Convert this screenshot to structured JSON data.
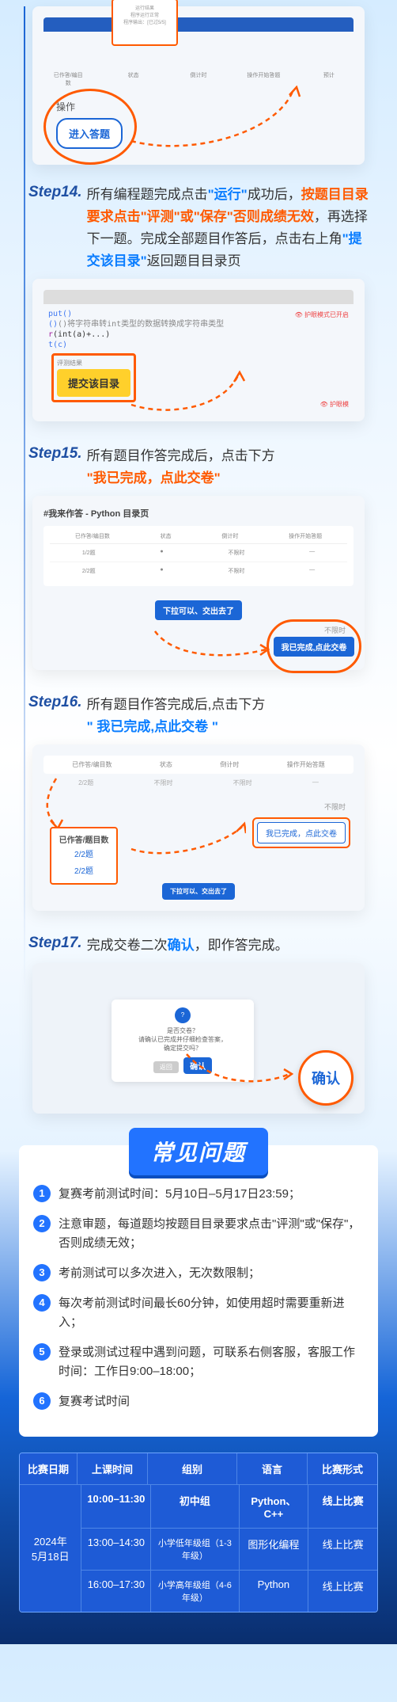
{
  "steps": {
    "s14": {
      "label": "Step14.",
      "text_parts": [
        "所有编程题完成点击",
        "\"运行\"",
        "成功后，",
        "按题目目录要求点击\"评测\"或\"保存\"否则成绩无效",
        "，再选择下一题。完成全部题目作答后，点击右上角",
        "\"提交该目录\"",
        "返回题目目录页"
      ],
      "screenshot_top": {
        "ops_label": "操作",
        "btn": "进入答题",
        "popup_lines": [
          "运行结果",
          "程序运行正常",
          "程序输出：[已过5/5]"
        ]
      },
      "screenshot_btm": {
        "code_hint": "put()",
        "code_cmt": "()将字符串转int类型的数据转换成字符串类型",
        "code_frag": "(int(a)+...)",
        "code_out": "t(c)",
        "btn": "提交该目录",
        "err_label": "评测结果",
        "badge": "护眼模式已开启"
      }
    },
    "s15": {
      "label": "Step15.",
      "text_parts": [
        "所有题目作答完成后，点击下方",
        "\"我已完成，点此交卷\""
      ],
      "screenshot": {
        "title": "#我来作答 - Python 目录页",
        "btn_center": "下拉可以、交出去了",
        "btn_circle": "我已完成,点此交卷",
        "not_timed": "不限时",
        "cols": [
          "已作答/编目数",
          "状态",
          "倒计时",
          "操作开始答题"
        ]
      }
    },
    "s16": {
      "label": "Step16.",
      "text_parts": [
        "所有题目作答完成后,点击下方",
        "\" 我已完成,点此交卷 \""
      ],
      "screenshot": {
        "box_title": "已作答/题目数",
        "box_l1": "2/2题",
        "box_l2": "2/2题",
        "btn": "我已完成，点此交卷",
        "not_timed": "不限时"
      }
    },
    "s17": {
      "label": "Step17.",
      "text_parts": [
        "完成交卷二次",
        "确认",
        "，即作答完成。"
      ],
      "screenshot": {
        "dialog_text": "是否交卷？\n请确认已完成并仔细检查答案，\n确定提交吗？",
        "btn_cancel": "返回",
        "btn_confirm": "确认"
      }
    }
  },
  "faq": {
    "title": "常见问题",
    "items": [
      "复赛考前测试时间：5月10日–5月17日23:59；",
      "注意审题，每道题均按题目目录要求点击\"评测\"或\"保存\"，否则成绩无效；",
      "考前测试可以多次进入，无次数限制；",
      "每次考前测试时间最长60分钟，如使用超时需要重新进入；",
      "登录或测试过程中遇到问题，可联系右侧客服，客服工作时间：工作日9:00–18:00；",
      "复赛考试时间"
    ]
  },
  "schedule": {
    "headers": [
      "比赛日期",
      "上课时间",
      "组别",
      "语言",
      "比赛形式"
    ],
    "date": "2024年\n5月18日",
    "rows": [
      {
        "time": "10:00–11:30",
        "group": "初中组",
        "lang": "Python、C++",
        "form": "线上比赛"
      },
      {
        "time": "13:00–14:30",
        "group": "小学低年级组（1-3年级）",
        "lang": "图形化编程",
        "form": "线上比赛"
      },
      {
        "time": "16:00–17:30",
        "group": "小学高年级组（4-6年级）",
        "lang": "Python",
        "form": "线上比赛"
      }
    ]
  }
}
